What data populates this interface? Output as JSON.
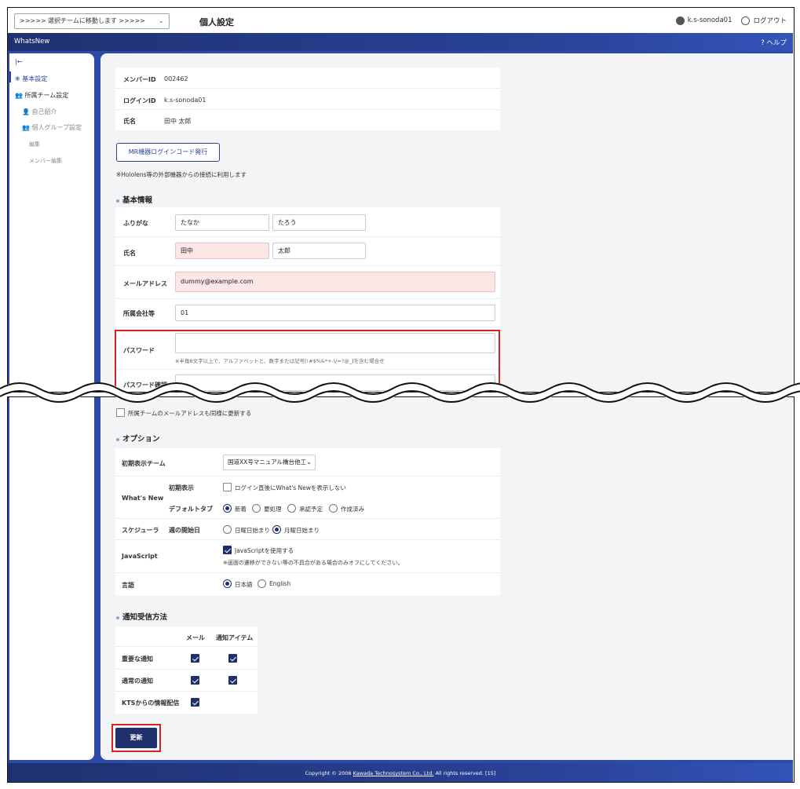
{
  "header": {
    "team_select": ">>>>> 選択チームに移動します >>>>>",
    "page_title": "個人設定",
    "user_name": "k.s-sonoda01",
    "logout": "ログアウト"
  },
  "navbar": {
    "brand": "WhatsNew",
    "help": "ヘルプ"
  },
  "sidebar": {
    "items": [
      {
        "label": "基本設定"
      },
      {
        "label": "所属チーム設定"
      },
      {
        "label": "自己紹介"
      },
      {
        "label": "個人グループ設定"
      },
      {
        "label": "編集"
      },
      {
        "label": "メンバー編集"
      }
    ]
  },
  "account": {
    "member_id_label": "メンバーID",
    "member_id": "002462",
    "login_id_label": "ログインID",
    "login_id": "k.s-sonoda01",
    "name_label": "氏名",
    "name": "田中 太郎",
    "mr_button": "MR機器ログインコード発行",
    "mr_note": "※Hololens等の外部機器からの接続に利用します"
  },
  "basic": {
    "title": "基本情報",
    "furigana_label": "ふりがな",
    "furigana_last": "たなか",
    "furigana_first": "たろう",
    "name_label": "氏名",
    "last_name": "田中",
    "first_name": "太郎",
    "email_label": "メールアドレス",
    "email": "dummy@example.com",
    "company_label": "所属会社等",
    "company": "01",
    "password_label": "パスワード",
    "password_note": "※半角8文字以上で、アルファベットと、数字または記号[!#$%&*+-\\/=?@_]を含む場合せ",
    "password_confirm_label": "パスワード確認",
    "team_mail_update": "所属チームのメールアドレスも同様に更新する"
  },
  "options": {
    "title": "オプション",
    "initial_team_label": "初期表示チーム",
    "initial_team_value": "国道XX号マニュアル橋台他工",
    "whatsnew_label": "What's New",
    "initial_display_label": "初期表示",
    "initial_display_option": "ログイン直後にWhat's Newを表示しない",
    "default_tab_label": "デフォルトタブ",
    "default_tabs": [
      "新着",
      "要処理",
      "承認予定",
      "作成済み"
    ],
    "scheduler_label": "スケジューラ",
    "week_start_label": "週の開始日",
    "week_start_options": [
      "日曜日始まり",
      "月曜日始まり"
    ],
    "javascript_label": "JavaScript",
    "javascript_option": "JavaScriptを使用する",
    "javascript_note": "※画面の遷移ができない等の不具合がある場合のみオフにしてください。",
    "language_label": "言語",
    "language_options": [
      "日本語",
      "English"
    ]
  },
  "notifications": {
    "title": "通知受信方法",
    "col_mail": "メール",
    "col_item": "通知アイテム",
    "rows": [
      {
        "label": "重要な通知",
        "mail": true,
        "item": true
      },
      {
        "label": "通常の通知",
        "mail": true,
        "item": true
      },
      {
        "label": "KTSからの情報配信",
        "mail": true,
        "item": null
      }
    ]
  },
  "update_button": "更新",
  "footer": {
    "prefix": "Copyright © 2006",
    "company": "Kawada Technosystem Co., Ltd.",
    "suffix": "All rights reserved.",
    "version": "[15]"
  },
  "colors": {
    "brand": "#2a4398",
    "required_bg": "#fde6e6",
    "highlight": "#d62222"
  }
}
